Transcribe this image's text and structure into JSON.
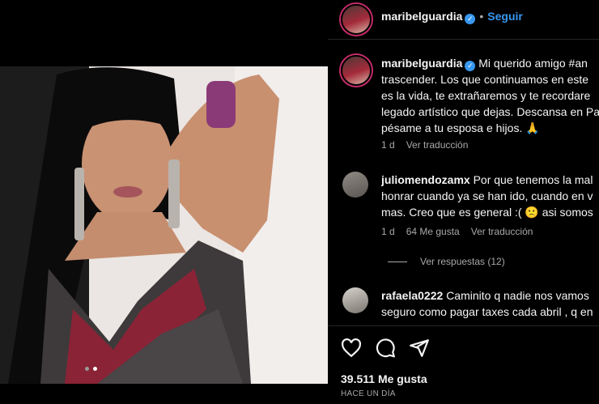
{
  "post": {
    "username": "maribelguardia",
    "verified": true,
    "follow_label": "Seguir",
    "separator": "•"
  },
  "caption": {
    "username": "maribelguardia",
    "text": "Mi querido amigo #an\ntrascender. Los que continuamos en este\nes la vida, te extrañaremos y te recordare\nlegado artístico que dejas. Descansa en Pa\npésame a tu esposa e hijos. 🙏",
    "time": "1 d",
    "translate_label": "Ver traducción"
  },
  "comments": [
    {
      "username": "juliomendozamx",
      "text": "Por que tenemos la mal\nhonrar cuando ya se han ido, cuando en v\nmas. Creo que es general :( 🙁 asi somos",
      "time": "1 d",
      "likes": "64 Me gusta",
      "translate_label": "Ver traducción",
      "replies_label": "Ver respuestas (12)"
    },
    {
      "username": "rafaela0222",
      "text": "Caminito q nadie nos vamos\nseguro como pagar taxes cada abril , q en"
    }
  ],
  "actions": {
    "icons": [
      "heart-icon",
      "comment-icon",
      "share-icon",
      "bookmark-icon"
    ]
  },
  "likes_count": "39.511 Me gusta",
  "posted_ago": "HACE UN DÍA",
  "carousel": {
    "slides": 2,
    "active": 2
  },
  "colors": {
    "accent": "#3897f0",
    "background": "#000000",
    "muted": "#a8a8a8"
  }
}
